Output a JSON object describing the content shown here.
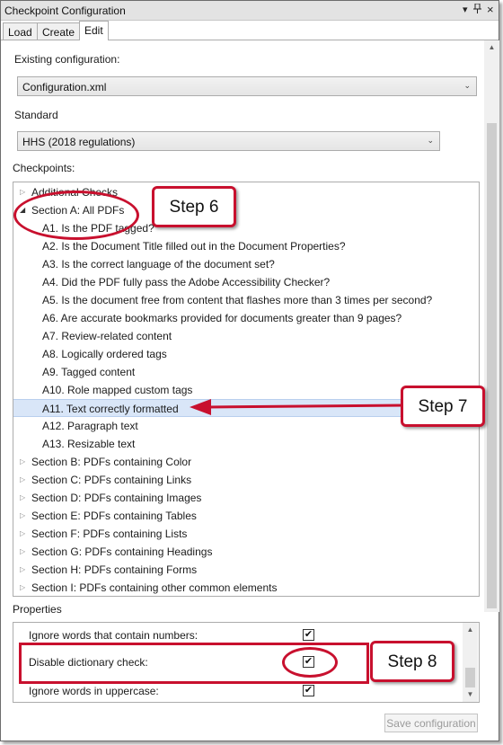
{
  "window": {
    "title": "Checkpoint Configuration",
    "pin_glyph": "▾ ⊓ ×"
  },
  "tabs": [
    {
      "label": "Load",
      "active": false
    },
    {
      "label": "Create",
      "active": false
    },
    {
      "label": "Edit",
      "active": true
    }
  ],
  "existing_configuration": {
    "label": "Existing configuration:",
    "value": "Configuration.xml"
  },
  "standard": {
    "label": "Standard",
    "value": "HHS (2018 regulations)"
  },
  "checkpoints": {
    "label": "Checkpoints:",
    "items": [
      {
        "text": "Additional Checks",
        "level": 0,
        "expander": "collapsed"
      },
      {
        "text": "Section A: All PDFs",
        "level": 0,
        "expander": "expanded"
      },
      {
        "text": "A1. Is the PDF tagged?",
        "level": 1
      },
      {
        "text": "A2. Is the Document Title filled out in the Document Properties?",
        "level": 1
      },
      {
        "text": "A3. Is the correct language of the document set?",
        "level": 1
      },
      {
        "text": "A4. Did the PDF fully pass the Adobe Accessibility Checker?",
        "level": 1
      },
      {
        "text": "A5. Is the document free from content that flashes more than 3 times per second?",
        "level": 1
      },
      {
        "text": "A6. Are accurate bookmarks provided for documents greater than 9 pages?",
        "level": 1
      },
      {
        "text": "A7. Review-related content",
        "level": 1
      },
      {
        "text": "A8. Logically ordered tags",
        "level": 1
      },
      {
        "text": "A9. Tagged content",
        "level": 1
      },
      {
        "text": "A10. Role mapped custom tags",
        "level": 1
      },
      {
        "text": "A11. Text correctly formatted",
        "level": 1,
        "selected": true
      },
      {
        "text": "A12. Paragraph text",
        "level": 1
      },
      {
        "text": "A13. Resizable text",
        "level": 1
      },
      {
        "text": "Section B: PDFs containing Color",
        "level": 0,
        "expander": "collapsed"
      },
      {
        "text": "Section C: PDFs containing Links",
        "level": 0,
        "expander": "collapsed"
      },
      {
        "text": "Section D: PDFs containing Images",
        "level": 0,
        "expander": "collapsed"
      },
      {
        "text": "Section E: PDFs containing Tables",
        "level": 0,
        "expander": "collapsed"
      },
      {
        "text": "Section F: PDFs containing Lists",
        "level": 0,
        "expander": "collapsed"
      },
      {
        "text": "Section G: PDFs containing Headings",
        "level": 0,
        "expander": "collapsed"
      },
      {
        "text": "Section H: PDFs containing Forms",
        "level": 0,
        "expander": "collapsed"
      },
      {
        "text": "Section I: PDFs containing other common elements",
        "level": 0,
        "expander": "collapsed"
      }
    ]
  },
  "properties": {
    "label": "Properties",
    "items": [
      {
        "text": "Ignore words that contain numbers:",
        "checked": true
      },
      {
        "text": "Disable dictionary check:",
        "checked": true
      },
      {
        "text": "Ignore words in uppercase:",
        "checked": true
      }
    ]
  },
  "save_button": "Save configuration",
  "callouts": {
    "step6": "Step 6",
    "step7": "Step 7",
    "step8": "Step 8",
    "color": "#c8102e"
  },
  "colors": {
    "selection": "#d9e6f8",
    "annotation": "#c8102e"
  }
}
